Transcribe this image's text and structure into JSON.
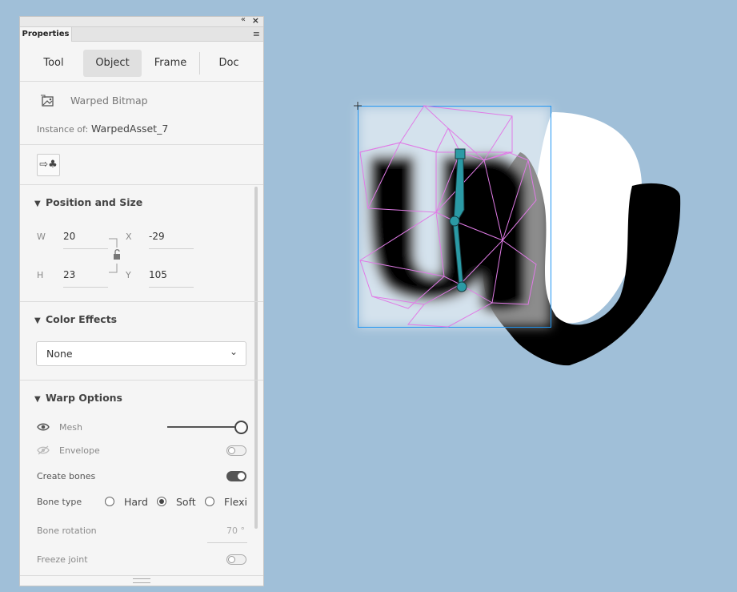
{
  "panel": {
    "tab_label": "Properties",
    "tabs": [
      "Tool",
      "Object",
      "Frame",
      "Doc"
    ],
    "active_tab": "Object"
  },
  "object": {
    "type_label": "Warped Bitmap",
    "instance_label": "Instance of:",
    "instance_value": "WarpedAsset_7"
  },
  "position": {
    "title": "Position and Size",
    "w_label": "W",
    "w_value": "20",
    "h_label": "H",
    "h_value": "23",
    "x_label": "X",
    "x_value": "-29",
    "y_label": "Y",
    "y_value": "105"
  },
  "color_effects": {
    "title": "Color Effects",
    "selected": "None"
  },
  "warp": {
    "title": "Warp Options",
    "mesh_label": "Mesh",
    "envelope_label": "Envelope",
    "create_bones_label": "Create bones",
    "create_bones_on": true,
    "bone_type_label": "Bone type",
    "bone_types": [
      "Hard",
      "Soft",
      "Flexi"
    ],
    "bone_type_selected": "Soft",
    "bone_rotation_label": "Bone rotation",
    "bone_rotation_value": "70 °",
    "freeze_joint_label": "Freeze joint"
  },
  "colors": {
    "canvas_bg": "#a0bfd8",
    "mesh_lines": "#e07be6",
    "bone_color": "#2b9aa5",
    "selection_box": "#2196f3"
  }
}
